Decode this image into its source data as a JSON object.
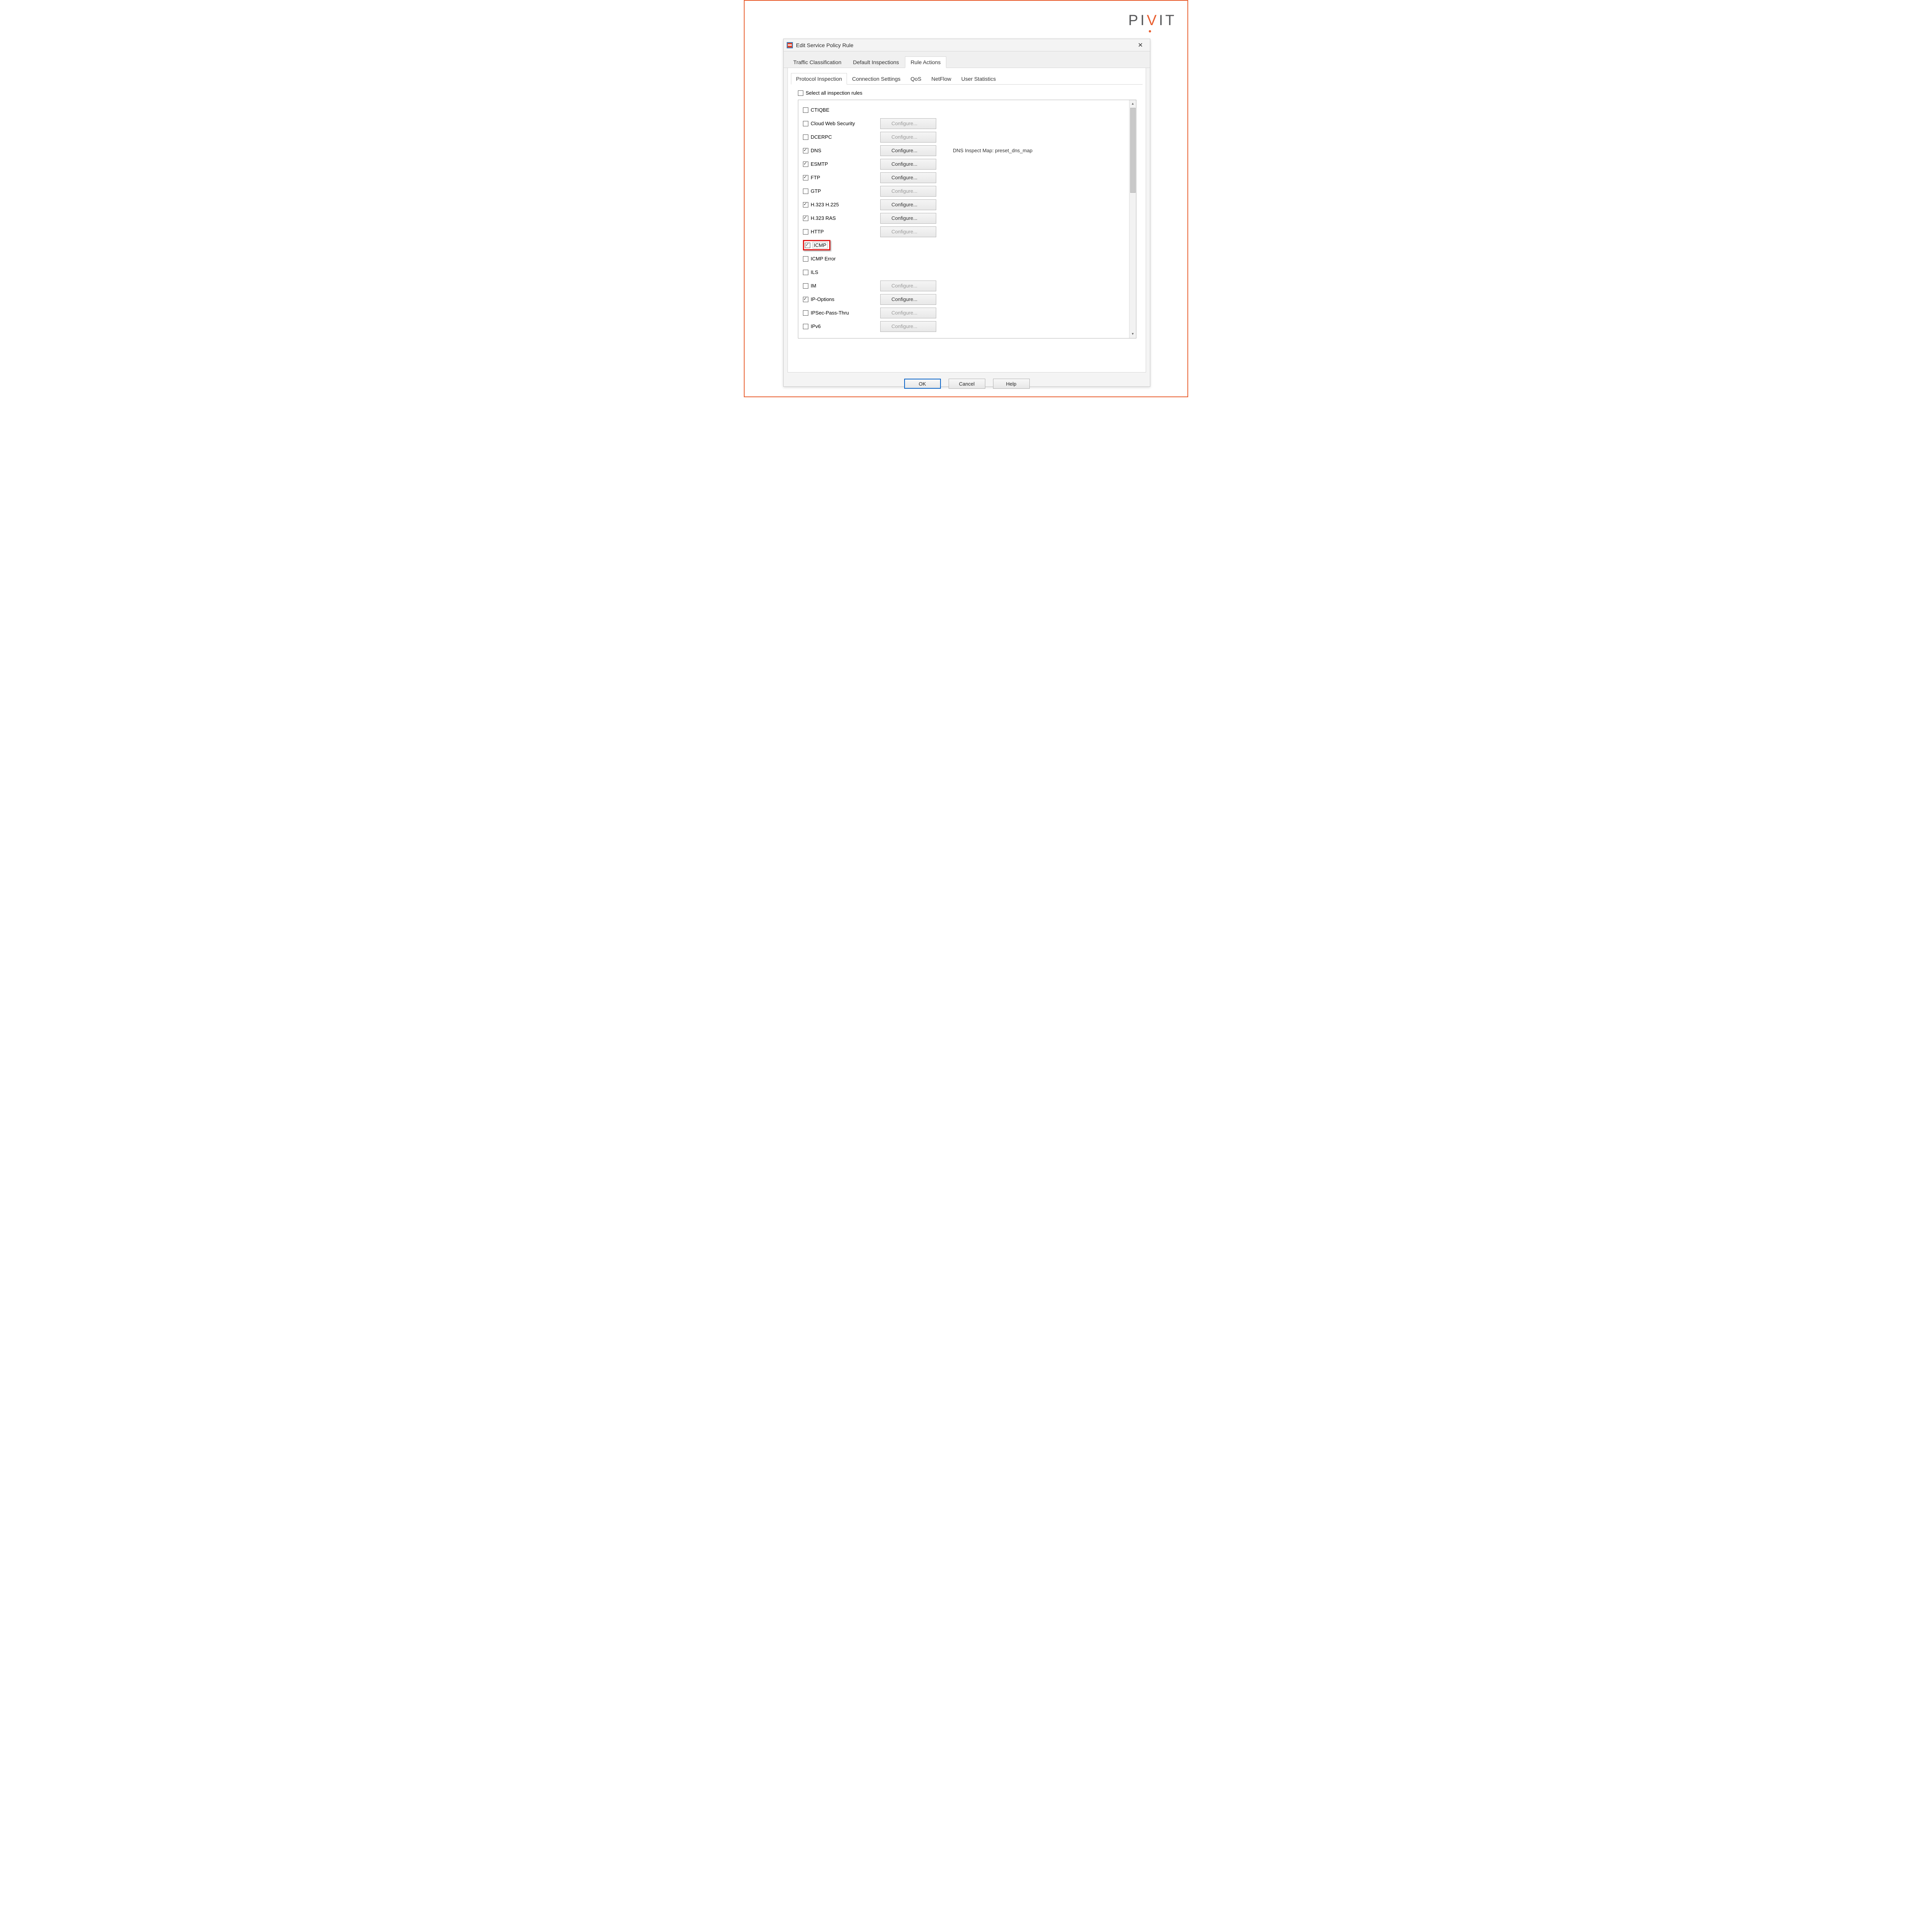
{
  "brand": {
    "text": "PIVIT"
  },
  "dialog": {
    "title": "Edit Service Policy Rule",
    "close_label": "✕",
    "outer_tabs": [
      "Traffic Classification",
      "Default Inspections",
      "Rule Actions"
    ],
    "outer_active": 2,
    "inner_tabs": [
      "Protocol Inspection",
      "Connection Settings",
      "QoS",
      "NetFlow",
      "User Statistics"
    ],
    "inner_active": 0,
    "select_all_label": "Select all inspection rules",
    "configure_label": "Configure...",
    "rules": [
      {
        "label": "CTIQBE",
        "checked": false,
        "has_button": false,
        "enabled": false,
        "info": ""
      },
      {
        "label": "Cloud Web Security",
        "checked": false,
        "has_button": true,
        "enabled": false,
        "info": ""
      },
      {
        "label": "DCERPC",
        "checked": false,
        "has_button": true,
        "enabled": false,
        "info": ""
      },
      {
        "label": "DNS",
        "checked": true,
        "has_button": true,
        "enabled": true,
        "info": "DNS Inspect Map: preset_dns_map"
      },
      {
        "label": "ESMTP",
        "checked": true,
        "has_button": true,
        "enabled": true,
        "info": ""
      },
      {
        "label": "FTP",
        "checked": true,
        "has_button": true,
        "enabled": true,
        "info": ""
      },
      {
        "label": "GTP",
        "checked": false,
        "has_button": true,
        "enabled": false,
        "info": ""
      },
      {
        "label": "H.323 H.225",
        "checked": true,
        "has_button": true,
        "enabled": true,
        "info": ""
      },
      {
        "label": "H.323 RAS",
        "checked": true,
        "has_button": true,
        "enabled": true,
        "info": ""
      },
      {
        "label": "HTTP",
        "checked": false,
        "has_button": true,
        "enabled": false,
        "info": ""
      },
      {
        "label": "ICMP",
        "checked": true,
        "has_button": false,
        "enabled": false,
        "info": "",
        "highlighted": true
      },
      {
        "label": "ICMP Error",
        "checked": false,
        "has_button": false,
        "enabled": false,
        "info": ""
      },
      {
        "label": "ILS",
        "checked": false,
        "has_button": false,
        "enabled": false,
        "info": ""
      },
      {
        "label": "IM",
        "checked": false,
        "has_button": true,
        "enabled": false,
        "info": ""
      },
      {
        "label": "IP-Options",
        "checked": true,
        "has_button": true,
        "enabled": true,
        "info": ""
      },
      {
        "label": "IPSec-Pass-Thru",
        "checked": false,
        "has_button": true,
        "enabled": false,
        "info": ""
      },
      {
        "label": "IPv6",
        "checked": false,
        "has_button": true,
        "enabled": false,
        "info": ""
      }
    ],
    "buttons": {
      "ok": "OK",
      "cancel": "Cancel",
      "help": "Help"
    }
  }
}
